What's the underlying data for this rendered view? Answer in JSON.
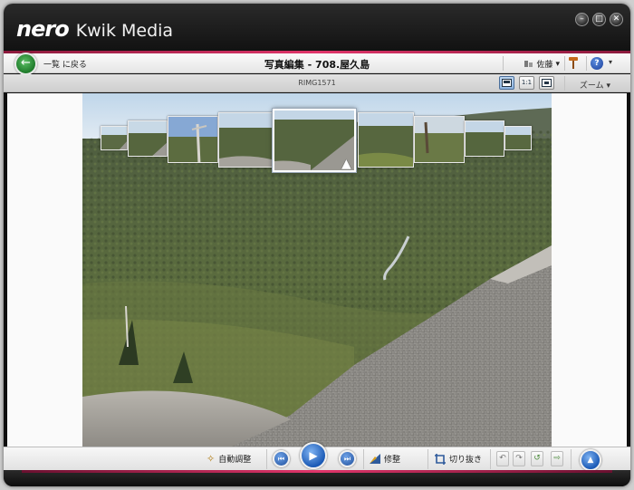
{
  "app": {
    "logo": "nero",
    "name": "Kwik Media"
  },
  "window_buttons": [
    {
      "name": "minimize",
      "glyph": "–"
    },
    {
      "name": "maximize",
      "glyph": "□"
    },
    {
      "name": "close",
      "glyph": "✕"
    }
  ],
  "toolbar": {
    "back_label": "一覧 に戻る",
    "album_title": "写真編集 - 708.屋久島",
    "user_name": "佐藤",
    "user_icon": "user-icon",
    "dropdown_glyph": "▾",
    "settings_icon": "hammer-icon",
    "help_glyph": "?"
  },
  "subbar": {
    "filename": "RIMG1571",
    "view_modes": [
      "single-view",
      "actual-size",
      "fit-to-window"
    ],
    "active_view": "single-view",
    "zoom_label": "ズーム ▾"
  },
  "filmstrip": {
    "thumbnail_count": 10,
    "current_index": 4,
    "prev_icon": "chevron-left-icon",
    "next_icon": "chevron-right-icon"
  },
  "bottom_bar": {
    "auto_adjust_label": "自動調整",
    "fix_label": "修整",
    "crop_label": "切り抜き"
  },
  "colors": {
    "accent_pink": "#e0356a",
    "play_blue": "#2b78d4",
    "back_green": "#2f9a3b",
    "title_bar": "#141414"
  }
}
